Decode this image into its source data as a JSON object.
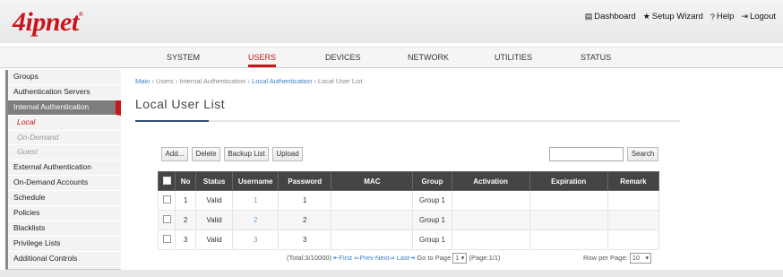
{
  "brand": {
    "logo_text": "4ipnet",
    "logo_mark": "®",
    "accent": "#c9161d"
  },
  "toplinks": [
    {
      "icon": "dashboard-icon",
      "glyph": "▤",
      "label": "Dashboard"
    },
    {
      "icon": "star-icon",
      "glyph": "★",
      "label": "Setup Wizard"
    },
    {
      "icon": "help-icon",
      "glyph": "?",
      "label": "Help"
    },
    {
      "icon": "logout-icon",
      "glyph": "⇥",
      "label": "Logout"
    }
  ],
  "nav": [
    {
      "label": "SYSTEM",
      "active": false
    },
    {
      "label": "USERS",
      "active": true
    },
    {
      "label": "DEVICES",
      "active": false
    },
    {
      "label": "NETWORK",
      "active": false
    },
    {
      "label": "UTILITIES",
      "active": false
    },
    {
      "label": "STATUS",
      "active": false
    }
  ],
  "sidebar": [
    {
      "label": "Groups"
    },
    {
      "label": "Authentication Servers"
    },
    {
      "label": "Internal Authentication",
      "active": true
    },
    {
      "label": "Local",
      "sub": true,
      "current": true
    },
    {
      "label": "On-Demand",
      "sub": true
    },
    {
      "label": "Guest",
      "sub": true
    },
    {
      "label": "External Authentication"
    },
    {
      "label": "On-Demand Accounts"
    },
    {
      "label": "Schedule"
    },
    {
      "label": "Policies"
    },
    {
      "label": "Blacklists"
    },
    {
      "label": "Privilege Lists"
    },
    {
      "label": "Additional Controls"
    }
  ],
  "breadcrumb": {
    "main": "Main",
    "sep": " › ",
    "users": "Users",
    "internal": "Internal Authentication",
    "local_auth": "Local Authentication",
    "current": "Local User List"
  },
  "page_title": "Local User List",
  "toolbar": {
    "add": "Add...",
    "delete": "Delete",
    "backup": "Backup List",
    "upload": "Upload",
    "search": "Search",
    "search_value": ""
  },
  "table": {
    "columns": [
      "No",
      "Status",
      "Username",
      "Password",
      "MAC",
      "Group",
      "Activation",
      "Expiration",
      "Remark"
    ],
    "rows": [
      {
        "no": "1",
        "status": "Valid",
        "username": "1",
        "password": "1",
        "mac": "",
        "group": "Group 1",
        "activation": "",
        "expiration": "",
        "remark": ""
      },
      {
        "no": "2",
        "status": "Valid",
        "username": "2",
        "password": "2",
        "mac": "",
        "group": "Group 1",
        "activation": "",
        "expiration": "",
        "remark": ""
      },
      {
        "no": "3",
        "status": "Valid",
        "username": "3",
        "password": "3",
        "mac": "",
        "group": "Group 1",
        "activation": "",
        "expiration": "",
        "remark": ""
      }
    ]
  },
  "pager": {
    "total": "(Total:3/10000)",
    "first": "⇤First",
    "prev": "⇐Prev",
    "next": "Next⇒",
    "last": "Last⇥",
    "goto_label": "Go to Page",
    "page_value": "1",
    "page_info": "(Page:1/1)",
    "rows_label": "Row per Page:",
    "rows_value": "10"
  }
}
